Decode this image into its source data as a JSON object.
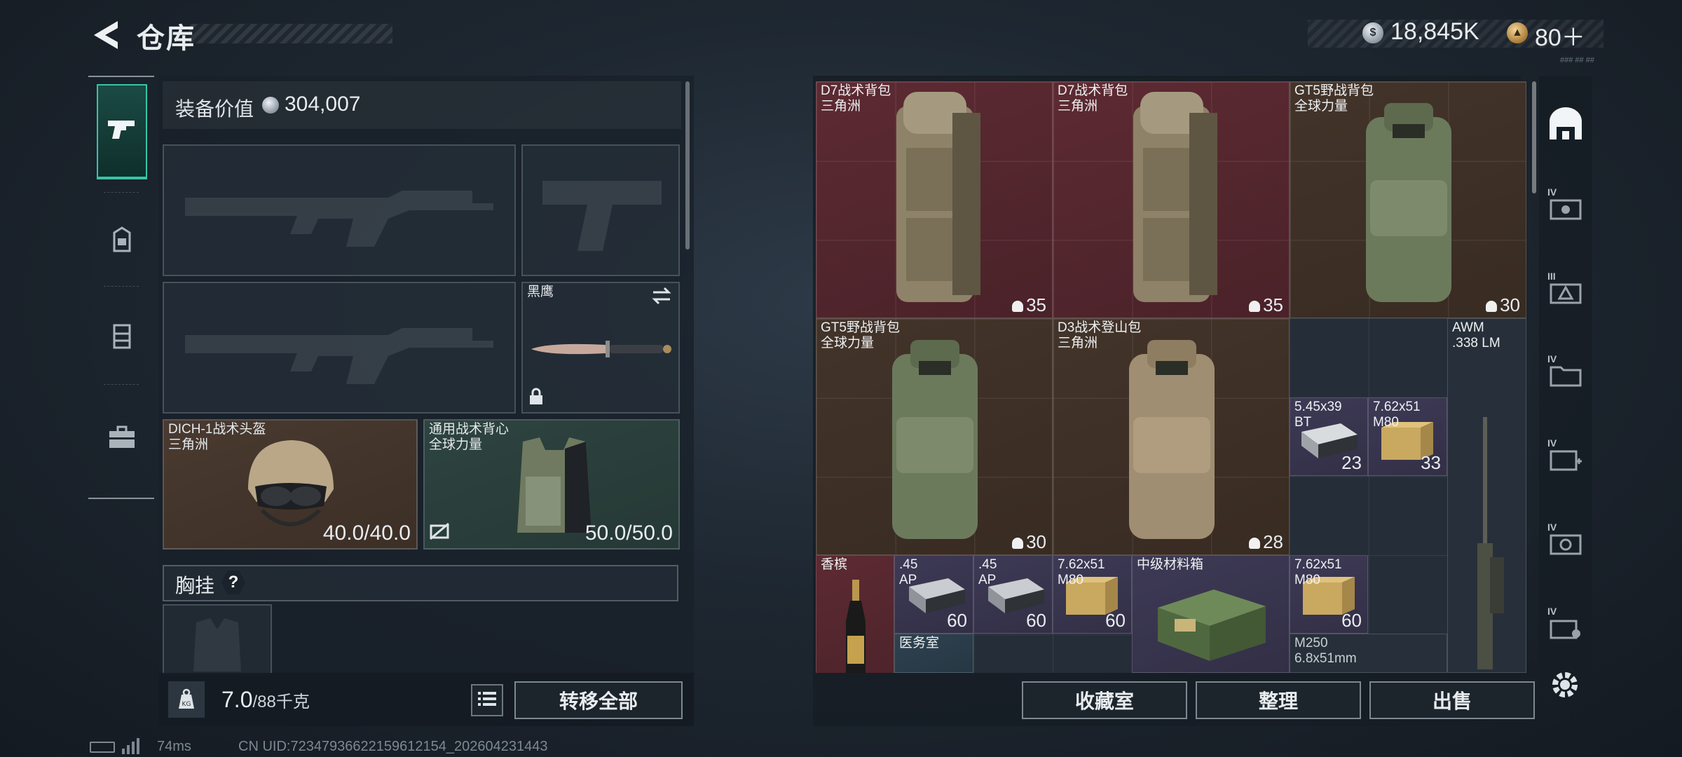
{
  "header": {
    "title": "仓库",
    "money": "18,845K",
    "tickets": "80＋",
    "version_tag": "### ## ##"
  },
  "loadout": {
    "equip_value_label": "装备价值",
    "equip_value": "304,007",
    "melee_name": "黑鹰",
    "helmet": {
      "title": "DICH-1战术头盔\n三角洲",
      "durability": "40.0/40.0"
    },
    "armor": {
      "title": "通用战术背心\n全球力量",
      "durability": "50.0/50.0"
    },
    "chest_rig_label": "胸挂",
    "help_glyph": "?",
    "weight_current": "7.0",
    "weight_max": "/88千克",
    "transfer_all": "转移全部"
  },
  "storage": {
    "items": [
      {
        "title": "D7战术背包\n三角洲",
        "count": "35"
      },
      {
        "title": "D7战术背包\n三角洲",
        "count": "35"
      },
      {
        "title": "GT5野战背包\n全球力量",
        "count": "30"
      },
      {
        "title": "GT5野战背包\n全球力量",
        "count": "30"
      },
      {
        "title": "D3战术登山包\n三角洲",
        "count": "28"
      },
      {
        "title": "AWM\n.338 LM",
        "count": ""
      },
      {
        "title": "5.45x39\nBT",
        "count": "23"
      },
      {
        "title": "7.62x51\nM80",
        "count": "33"
      },
      {
        "title": "香槟",
        "count": ""
      },
      {
        "title": ".45\nAP",
        "count": "60"
      },
      {
        "title": ".45\nAP",
        "count": "60"
      },
      {
        "title": "7.62x51\nM80",
        "count": "60"
      },
      {
        "title": "中级材料箱",
        "count": ""
      },
      {
        "title": "7.62x51\nM80",
        "count": "60"
      },
      {
        "title": "医务室",
        "count": ""
      },
      {
        "title": "M250\n6.8x51mm",
        "count": ""
      }
    ]
  },
  "bottom_buttons": {
    "collection": "收藏室",
    "organize": "整理",
    "sell": "出售"
  },
  "footer": {
    "ping": "74ms",
    "uid": "CN UID:7234793662215961215​4_202604231443"
  },
  "colors": {
    "accent": "#39c3a5",
    "rarity_red": "#5d2a32",
    "rarity_gold": "#43342a",
    "rarity_purple": "#3e3a56"
  }
}
